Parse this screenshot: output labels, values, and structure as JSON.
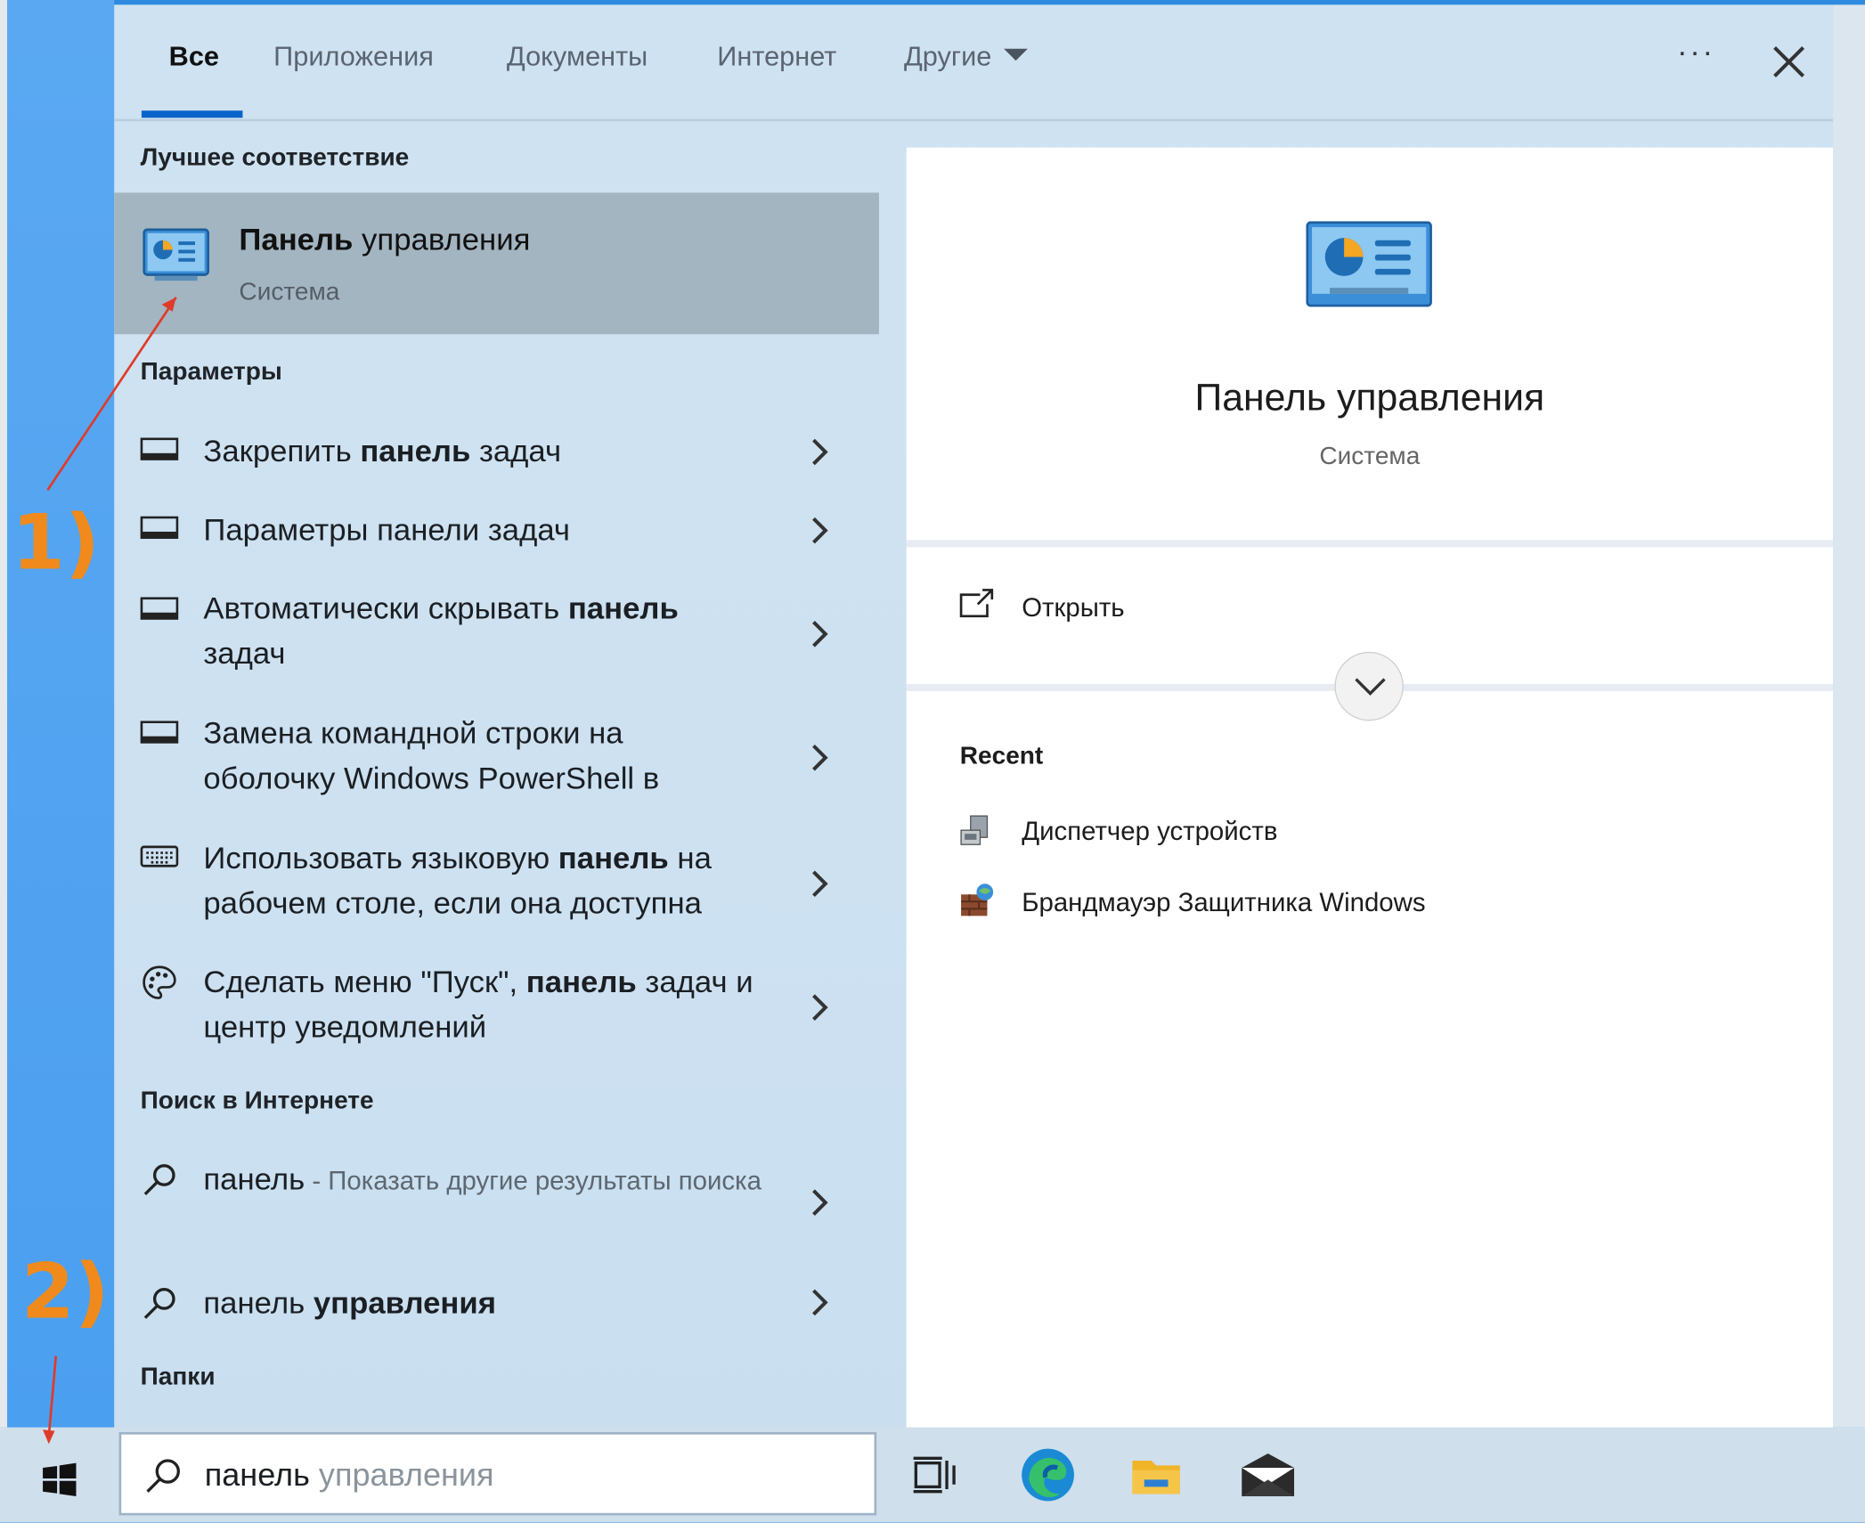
{
  "tabs": [
    {
      "label": "Все"
    },
    {
      "label": "Приложения"
    },
    {
      "label": "Документы"
    },
    {
      "label": "Интернет"
    },
    {
      "label": "Другие"
    }
  ],
  "more_label": "···",
  "sections": {
    "best_match": "Лучшее соответствие",
    "settings": "Параметры",
    "web": "Поиск в Интернете",
    "folders": "Папки"
  },
  "best": {
    "title_bold": "Панель",
    "title_rest": " управления",
    "subtitle": "Система"
  },
  "settings_items": [
    {
      "pre": "Закрепить ",
      "bold": "панель",
      "post": " задач",
      "icon": "taskbar-icon"
    },
    {
      "pre": "Параметры панели задач",
      "bold": "",
      "post": "",
      "icon": "taskbar-icon"
    },
    {
      "pre": "Автоматически скрывать ",
      "bold": "панель",
      "post": " задач",
      "icon": "taskbar-icon"
    },
    {
      "pre": "Замена командной строки на оболочку Windows PowerShell в",
      "bold": "",
      "post": "",
      "icon": "taskbar-icon"
    },
    {
      "pre": "Использовать языковую ",
      "bold": "панель",
      "post": " на рабочем столе, если она доступна",
      "icon": "keyboard-icon"
    },
    {
      "pre": "Сделать меню \"Пуск\", ",
      "bold": "панель",
      "post": " задач и центр уведомлений",
      "icon": "palette-icon"
    }
  ],
  "web_items": [
    {
      "main": "панель",
      "muted": " - Показать другие результаты поиска"
    },
    {
      "main": "панель ",
      "bold": "управления"
    }
  ],
  "preview": {
    "title": "Панель управления",
    "subtitle": "Система",
    "open_label": "Открыть",
    "recent_heading": "Recent",
    "recent": [
      {
        "label": "Диспетчер устройств",
        "icon": "device-manager-icon"
      },
      {
        "label": "Брандмауэр Защитника Windows",
        "icon": "firewall-icon"
      }
    ]
  },
  "search": {
    "typed": "панель",
    "ghost": " управления"
  },
  "annotations": {
    "one": "1)",
    "two": "2)"
  },
  "colors": {
    "accent": "#0a64c9",
    "annotation": "#f08a1c",
    "arrow": "#e03a2a"
  }
}
